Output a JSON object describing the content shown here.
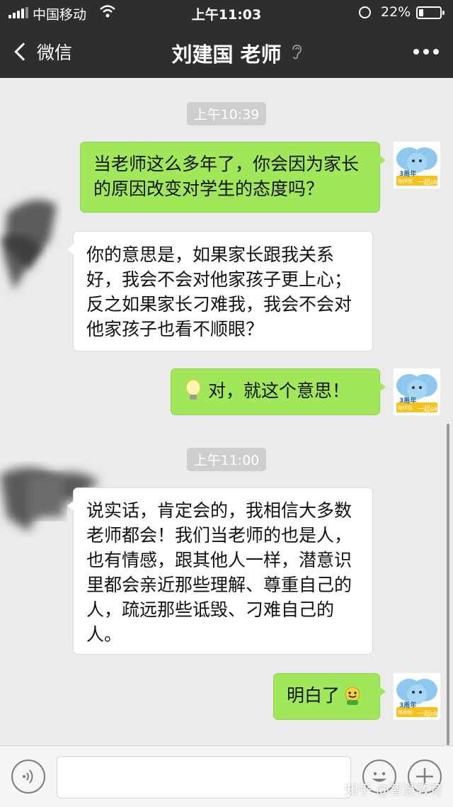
{
  "status_bar": {
    "carrier": "中国移动",
    "time": "上午11:03",
    "battery": "22%",
    "battery_level": 0.22,
    "icons": [
      "signal-icon",
      "wifi-icon",
      "orientation-lock-icon",
      "battery-icon"
    ]
  },
  "nav": {
    "back_label": "微信",
    "title": "刘建国 老师",
    "icons": [
      "chevron-left-icon",
      "ear-icon",
      "more-icon"
    ]
  },
  "chat": {
    "timestamps": [
      "上午10:39",
      "上午11:00"
    ],
    "messages": [
      {
        "from": "me",
        "text": "当老师这么多年了，你会因为家长的原因改变对学生的态度吗？"
      },
      {
        "from": "teacher",
        "text": "你的意思是，如果家长跟我关系好，我会不会对他家孩子更上心；反之如果家长刁难我，我会不会对他家孩子也看不顺眼？"
      },
      {
        "from": "me",
        "text": "对，就这个意思！",
        "emoji": "lightbulb-icon"
      },
      {
        "from": "teacher",
        "text": "说实话，肯定会的，我相信大多数老师都会！我们当老师的也是人，也有情感，跟其他人一样，潜意识里都会亲近那些理解、尊重自己的人，疏远那些诋毁、刁难自己的人。"
      },
      {
        "from": "me",
        "text": "明白了",
        "emoji": "grin-sticker-icon"
      }
    ],
    "my_avatar": {
      "badge": "3周年",
      "caption": "一起ok",
      "small": "陪伴你"
    }
  },
  "input_bar": {
    "icons": [
      "voice-icon",
      "emoji-icon",
      "plus-icon"
    ]
  },
  "watermark": "知乎 @智慧教育",
  "colors": {
    "header": "#2e2e2e",
    "chat_bg": "#ebebeb",
    "outgoing_bubble": "#a0e75a",
    "incoming_bubble": "#ffffff",
    "timestamp_bg": "#cecece"
  }
}
